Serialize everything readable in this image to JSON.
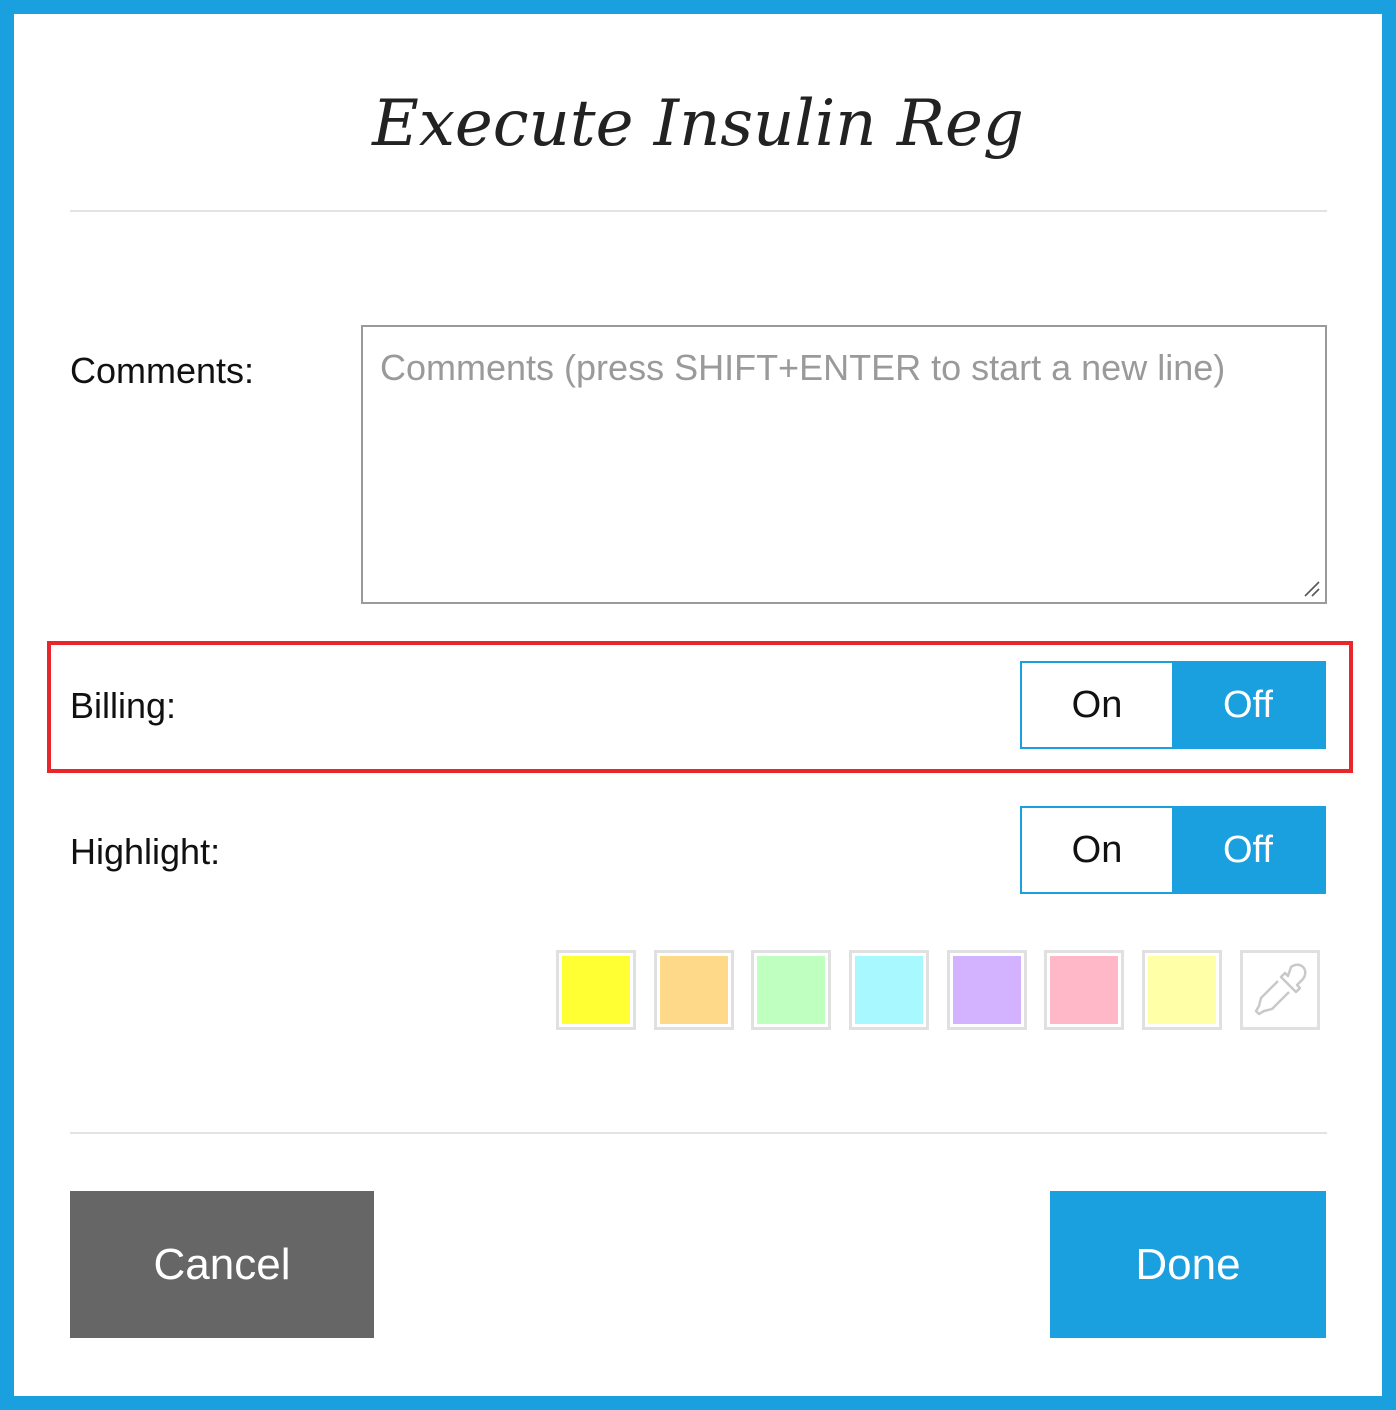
{
  "dialog": {
    "title": "Execute Insulin Reg"
  },
  "comments": {
    "label": "Comments:",
    "placeholder": "Comments (press SHIFT+ENTER to start a new line)",
    "value": ""
  },
  "billing": {
    "label": "Billing:",
    "on_label": "On",
    "off_label": "Off",
    "selected": "Off"
  },
  "highlight": {
    "label": "Highlight:",
    "on_label": "On",
    "off_label": "Off",
    "selected": "Off",
    "colors": [
      "#ffff33",
      "#ffd98a",
      "#bfffbf",
      "#a8f8ff",
      "#d3b3ff",
      "#ffb8c8",
      "#ffffa8"
    ],
    "picker_icon": "eyedropper-icon"
  },
  "actions": {
    "cancel_label": "Cancel",
    "done_label": "Done"
  },
  "theme": {
    "accent": "#1a9fdf",
    "cancel_bg": "#666666",
    "highlight_outline": "#e8262b"
  }
}
